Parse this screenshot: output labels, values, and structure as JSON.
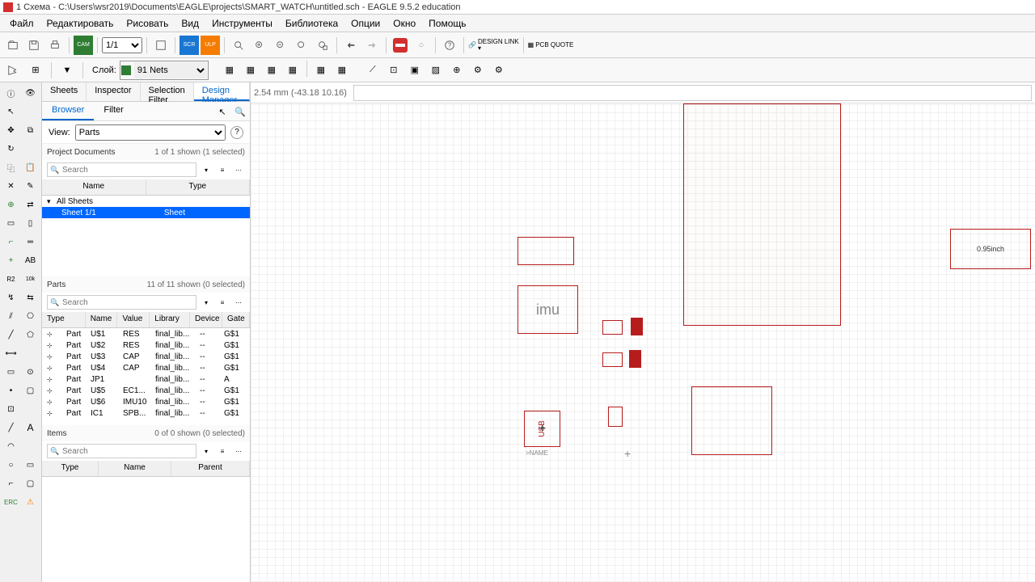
{
  "titlebar": {
    "text": "1 Схема - C:\\Users\\wsr2019\\Documents\\EAGLE\\projects\\SMART_WATCH\\untitled.sch - EAGLE 9.5.2 education"
  },
  "menu": [
    "Файл",
    "Редактировать",
    "Рисовать",
    "Вид",
    "Инструменты",
    "Библиотека",
    "Опции",
    "Окно",
    "Помощь"
  ],
  "toolbar": {
    "page": "1/1",
    "design_link": "DESIGN LINK",
    "pcb_quote": "PCB QUOTE"
  },
  "layerbar": {
    "label": "Слой:",
    "layer": "91 Nets"
  },
  "panel": {
    "tabs": [
      "Sheets",
      "Inspector",
      "Selection Filter",
      "Design Manager"
    ],
    "active_tab": 3,
    "sub_tabs": [
      "Browser",
      "Filter"
    ],
    "active_sub": 0,
    "view_label": "View:",
    "view_value": "Parts",
    "proj_docs": {
      "title": "Project Documents",
      "count": "1 of 1 shown (1 selected)",
      "search_placeholder": "Search",
      "cols": [
        "Name",
        "Type"
      ],
      "items": [
        {
          "name": "All Sheets",
          "expanded": true,
          "children": [
            {
              "name": "Sheet 1/1",
              "type": "Sheet",
              "selected": true
            }
          ]
        }
      ]
    },
    "parts": {
      "title": "Parts",
      "count": "11 of 11 shown (0 selected)",
      "search_placeholder": "Search",
      "cols": [
        "Type",
        "Name",
        "Value",
        "Library",
        "Device",
        "Gate"
      ],
      "rows": [
        {
          "type": "Part",
          "name": "U$1",
          "value": "RES",
          "library": "final_lib...",
          "device": "--",
          "gate": "G$1"
        },
        {
          "type": "Part",
          "name": "U$2",
          "value": "RES",
          "library": "final_lib...",
          "device": "--",
          "gate": "G$1"
        },
        {
          "type": "Part",
          "name": "U$3",
          "value": "CAP",
          "library": "final_lib...",
          "device": "--",
          "gate": "G$1"
        },
        {
          "type": "Part",
          "name": "U$4",
          "value": "CAP",
          "library": "final_lib...",
          "device": "--",
          "gate": "G$1"
        },
        {
          "type": "Part",
          "name": "JP1",
          "value": "",
          "library": "final_lib...",
          "device": "--",
          "gate": "A"
        },
        {
          "type": "Part",
          "name": "U$5",
          "value": "EC1...",
          "library": "final_lib...",
          "device": "--",
          "gate": "G$1"
        },
        {
          "type": "Part",
          "name": "U$6",
          "value": "IMU10",
          "library": "final_lib...",
          "device": "--",
          "gate": "G$1"
        },
        {
          "type": "Part",
          "name": "IC1",
          "value": "SPB...",
          "library": "final_lib...",
          "device": "--",
          "gate": "G$1"
        }
      ]
    },
    "items": {
      "title": "Items",
      "count": "0 of 0 shown (0 selected)",
      "search_placeholder": "Search",
      "cols": [
        "Type",
        "Name",
        "Parent"
      ]
    }
  },
  "canvas": {
    "coords": "2.54 mm (-43.18 10.16)",
    "cmd_placeholder": "",
    "parts": {
      "imu_label": "imu",
      "usb_label": "USB",
      "name_label": ">NAME",
      "display_label": "0.95inch"
    }
  }
}
